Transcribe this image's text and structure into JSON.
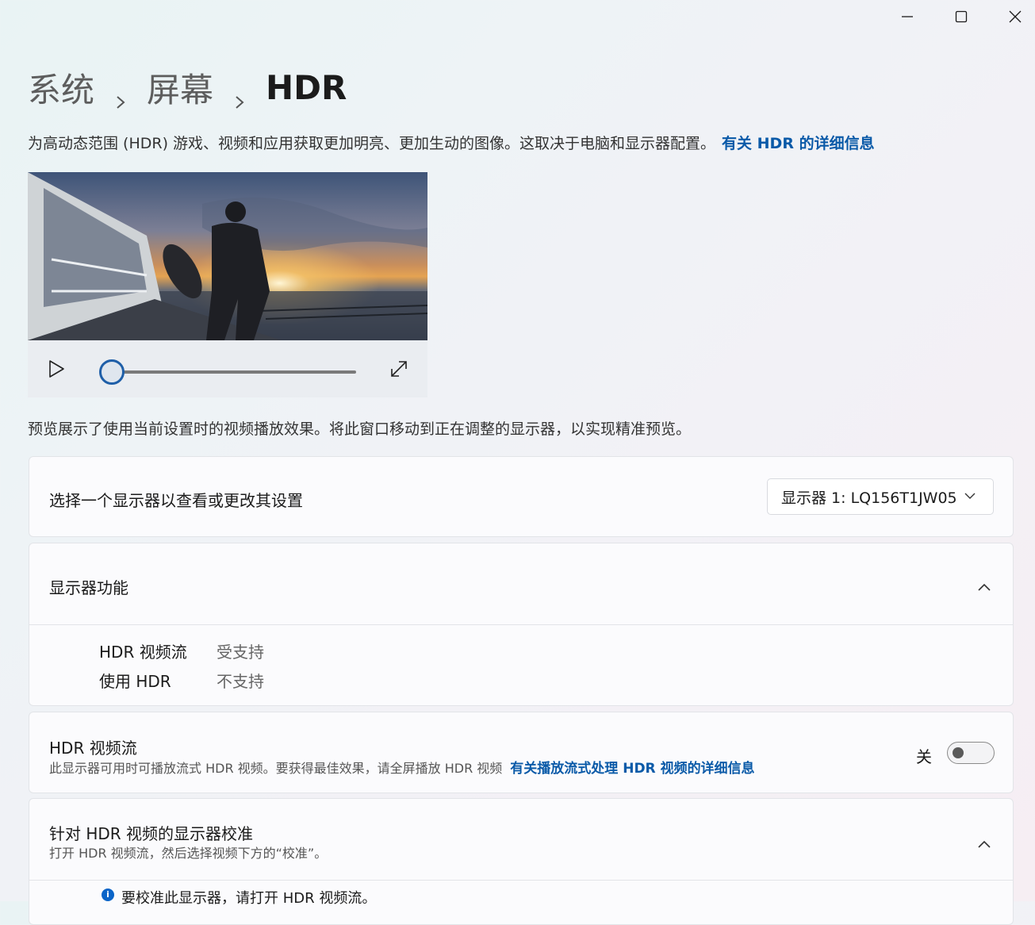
{
  "breadcrumb": {
    "items": [
      "系统",
      "屏幕"
    ],
    "current": "HDR"
  },
  "description": {
    "text": "为高动态范围 (HDR) 游戏、视频和应用获取更加明亮、更加生动的图像。这取决于电脑和显示器配置。",
    "link": "有关 HDR 的详细信息"
  },
  "video_preview": {
    "progress": 0
  },
  "preview_note": "预览展示了使用当前设置时的视频播放效果。将此窗口移动到正在调整的显示器，以实现精准预览。",
  "display_select": {
    "label": "选择一个显示器以查看或更改其设置",
    "selected": "显示器 1: LQ156T1JW05"
  },
  "display_features": {
    "title": "显示器功能",
    "rows": [
      {
        "name": "HDR 视频流",
        "value": "受支持"
      },
      {
        "name": "使用 HDR",
        "value": "不支持"
      }
    ]
  },
  "hdr_streaming": {
    "title": "HDR 视频流",
    "subtitle": "此显示器可用时可播放流式 HDR 视频。要获得最佳效果，请全屏播放 HDR 视频",
    "link": "有关播放流式处理 HDR 视频的详细信息",
    "toggle_label": "关",
    "toggle_on": false
  },
  "calibration": {
    "title": "针对 HDR 视频的显示器校准",
    "subtitle": "打开 HDR 视频流，然后选择视频下方的“校准”。",
    "info": "要校准此显示器，请打开 HDR 视频流。"
  },
  "colors": {
    "accent": "#0a5aa8",
    "slider_thumb": "#1f5fa8",
    "info": "#0a64c8"
  },
  "icons": [
    "minimize-icon",
    "maximize-icon",
    "close-icon",
    "play-icon",
    "fullscreen-icon",
    "chevron-down-icon",
    "chevron-up-icon",
    "info-icon"
  ]
}
